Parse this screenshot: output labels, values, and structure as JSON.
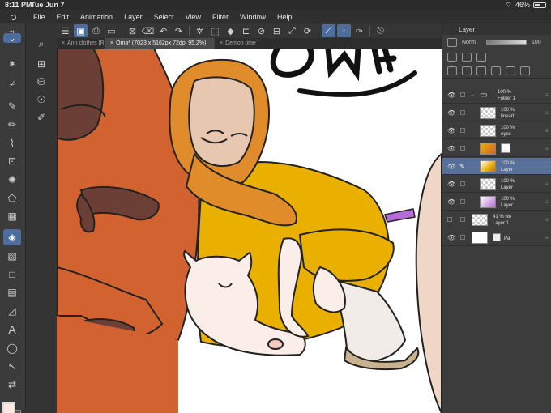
{
  "status": {
    "time": "8:11 PM",
    "date": "Tue Jun 7",
    "battery": "46%"
  },
  "menu": {
    "items": [
      "File",
      "Edit",
      "Animation",
      "Layer",
      "Select",
      "View",
      "Filter",
      "Window",
      "Help"
    ]
  },
  "tabs": [
    {
      "label": "Ann clothes [R",
      "active": false
    },
    {
      "label": "Oma* (7023 x 5162px 72dpi 95.2%)",
      "active": true
    },
    {
      "label": "Demon time",
      "active": false
    }
  ],
  "layer_panel": {
    "title": "Layer",
    "blend_mode": "Norm",
    "opacity": "100",
    "layers": [
      {
        "opacity": "100 %",
        "name": "Folder 1",
        "kind": "folder",
        "selected": false
      },
      {
        "opacity": "100 %",
        "name": "lineart",
        "kind": "raster",
        "selected": false
      },
      {
        "opacity": "100 %",
        "name": "eyes",
        "kind": "raster",
        "selected": false
      },
      {
        "opacity": "100 %",
        "name": "",
        "kind": "color",
        "selected": false
      },
      {
        "opacity": "100 %",
        "name": "Layer",
        "kind": "color",
        "selected": true
      },
      {
        "opacity": "100 %",
        "name": "Layer",
        "kind": "raster",
        "selected": false
      },
      {
        "opacity": "100 %",
        "name": "Layer",
        "kind": "purple",
        "selected": false
      },
      {
        "opacity": "41 % No",
        "name": "Layer 1",
        "kind": "raster",
        "selected": false
      },
      {
        "opacity": "100 %",
        "name": "Pa",
        "kind": "paper",
        "selected": false
      }
    ]
  },
  "canvas_text": "OMA",
  "colors": {
    "accent": "#4d6e9c",
    "orange_coat": "#d2622f",
    "mustard_dress": "#e9b000",
    "scarf": "#e08c2b",
    "skin": "#e8c7b0",
    "cat": "#fbeee8",
    "main_color": "#fce8dc"
  },
  "icons": [
    "menu-icon",
    "save-icon",
    "undo-icon",
    "redo-icon",
    "transform-icon",
    "brush-icon",
    "eraser-icon",
    "fill-icon",
    "text-icon",
    "eyedropper-icon",
    "lasso-icon",
    "gradient-icon",
    "eye-icon",
    "lock-icon",
    "folder-icon",
    "trash-icon"
  ]
}
